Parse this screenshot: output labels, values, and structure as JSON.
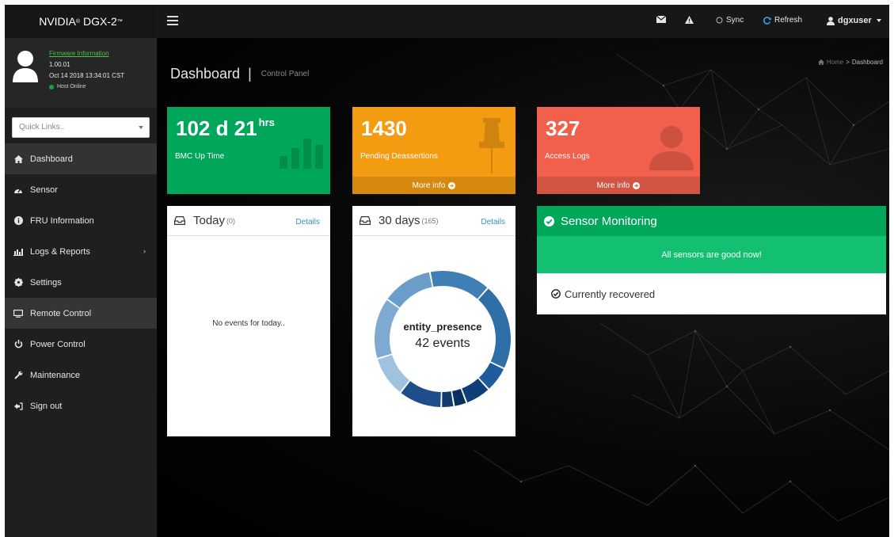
{
  "brand": {
    "name": "NVIDIA",
    "reg": "®",
    "model": "DGX-2",
    "tm": "™"
  },
  "user_panel": {
    "firmware_link": "Firmware Information",
    "version": "1.00.01",
    "build_date": "Oct 14 2018 13:34:01 CST",
    "host_status": "Host Online"
  },
  "quick_links": {
    "placeholder": "Quick Links.."
  },
  "menu": [
    {
      "label": "Dashboard",
      "icon": "home-icon"
    },
    {
      "label": "Sensor",
      "icon": "dashboard-icon"
    },
    {
      "label": "FRU Information",
      "icon": "info-icon"
    },
    {
      "label": "Logs & Reports",
      "icon": "bar-chart-icon",
      "chevron": "›"
    },
    {
      "label": "Settings",
      "icon": "gear-icon"
    },
    {
      "label": "Remote Control",
      "icon": "monitor-icon"
    },
    {
      "label": "Power Control",
      "icon": "power-icon"
    },
    {
      "label": "Maintenance",
      "icon": "wrench-icon"
    },
    {
      "label": "Sign out",
      "icon": "sign-out-icon"
    }
  ],
  "topbar": {
    "sync": "Sync",
    "refresh": "Refresh",
    "user": "dgxuser"
  },
  "page": {
    "title": "Dashboard",
    "separator": "|",
    "subtitle": "Control Panel",
    "breadcrumb_home": "Home",
    "breadcrumb_sep": ">",
    "breadcrumb_current": "Dashboard"
  },
  "boxes": {
    "uptime": {
      "value": "102 d 21",
      "unit": "hrs",
      "label": "BMC Up Time",
      "color": "#00a65a"
    },
    "pending": {
      "value": "1430",
      "label": "Pending Deassertions",
      "more": "More info",
      "color": "#f39c12"
    },
    "access": {
      "value": "327",
      "label": "Access Logs",
      "more": "More info",
      "color": "#f0604d"
    }
  },
  "today_panel": {
    "title": "Today",
    "count": "(0)",
    "details": "Details",
    "empty": "No events for today.."
  },
  "days_panel": {
    "title": "30 days",
    "count": "(165)",
    "details": "Details"
  },
  "chart_data": {
    "type": "pie",
    "center_label": "entity_presence",
    "center_value": "42 events",
    "values": [
      20,
      24,
      34,
      10,
      10,
      5,
      5,
      17,
      16,
      24
    ],
    "colors": [
      "#6a9ec8",
      "#3f7fb5",
      "#2f6fa8",
      "#1e5c9d",
      "#0f3f78",
      "#0b2f5e",
      "#123a6c",
      "#1d4e8a",
      "#9fc2e0",
      "#7eaad2"
    ]
  },
  "sensor_monitoring": {
    "title": "Sensor Monitoring",
    "status": "All sensors are good now!",
    "recovered": "Currently recovered"
  }
}
